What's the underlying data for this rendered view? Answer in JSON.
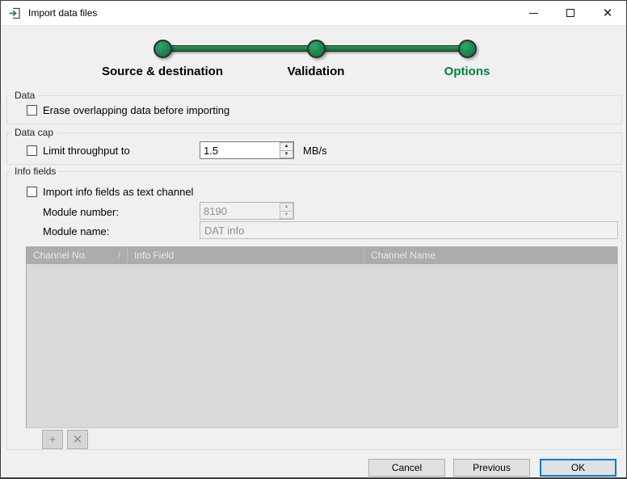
{
  "window": {
    "title": "Import data files",
    "controls": {
      "minimize": "minimize",
      "maximize": "maximize",
      "close_glyph": "✕"
    }
  },
  "stepper": {
    "steps": [
      {
        "label": "Source & destination",
        "active": false
      },
      {
        "label": "Validation",
        "active": false
      },
      {
        "label": "Options",
        "active": true
      }
    ],
    "accent_color": "#1c7f47",
    "active_label_color": "#00813f"
  },
  "sections": {
    "data": {
      "title": "Data",
      "checkbox_label": "Erase overlapping data before importing",
      "checked": false
    },
    "data_cap": {
      "title": "Data cap",
      "checkbox_label": "Limit throughput to",
      "checked": false,
      "throughput_value": "1.5",
      "unit": "MB/s"
    },
    "info_fields": {
      "title": "Info fields",
      "checkbox_label": "Import info fields as text channel",
      "checked": false,
      "module_number_label": "Module number:",
      "module_number_value": "8190",
      "module_name_label": "Module name:",
      "module_name_value": "DAT info",
      "table": {
        "columns": [
          "Channel No.",
          "Info Field",
          "Channel Name"
        ],
        "sort_glyph": "/",
        "rows": []
      },
      "add_button_glyph": "+",
      "remove_button_glyph": "✕"
    }
  },
  "icons": {
    "spin_up": "▲",
    "spin_down": "▼"
  },
  "footer": {
    "cancel_label": "Cancel",
    "previous_label": "Previous",
    "ok_label": "OK"
  }
}
